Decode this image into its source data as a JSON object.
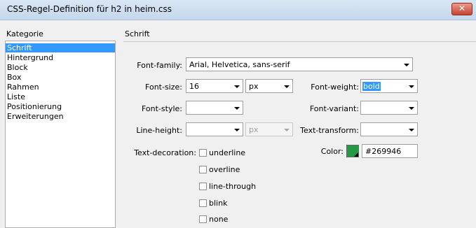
{
  "window": {
    "title": "CSS-Regel-Definition für h2 in heim.css",
    "close_glyph": "✕"
  },
  "sidebar": {
    "header": "Kategorie",
    "items": [
      {
        "label": "Schrift",
        "selected": true
      },
      {
        "label": "Hintergrund",
        "selected": false
      },
      {
        "label": "Block",
        "selected": false
      },
      {
        "label": "Box",
        "selected": false
      },
      {
        "label": "Rahmen",
        "selected": false
      },
      {
        "label": "Liste",
        "selected": false
      },
      {
        "label": "Positionierung",
        "selected": false
      },
      {
        "label": "Erweiterungen",
        "selected": false
      }
    ]
  },
  "panel": {
    "header": "Schrift",
    "font_family": {
      "label": "Font-family:",
      "value": "Arial, Helvetica, sans-serif"
    },
    "font_size": {
      "label": "Font-size:",
      "value": "16",
      "unit": "px"
    },
    "font_weight": {
      "label": "Font-weight:",
      "value": "bold"
    },
    "font_style": {
      "label": "Font-style:",
      "value": ""
    },
    "font_variant": {
      "label": "Font-variant:",
      "value": ""
    },
    "line_height": {
      "label": "Line-height:",
      "value": "",
      "unit": "px"
    },
    "text_transform": {
      "label": "Text-transform:",
      "value": ""
    },
    "color": {
      "label": "Color:",
      "value": "#269946",
      "swatch": "#269946"
    },
    "text_decoration": {
      "label": "Text-decoration:",
      "options": [
        {
          "label": "underline",
          "checked": false
        },
        {
          "label": "overline",
          "checked": false
        },
        {
          "label": "line-through",
          "checked": false
        },
        {
          "label": "blink",
          "checked": false
        },
        {
          "label": "none",
          "checked": false
        }
      ]
    }
  }
}
